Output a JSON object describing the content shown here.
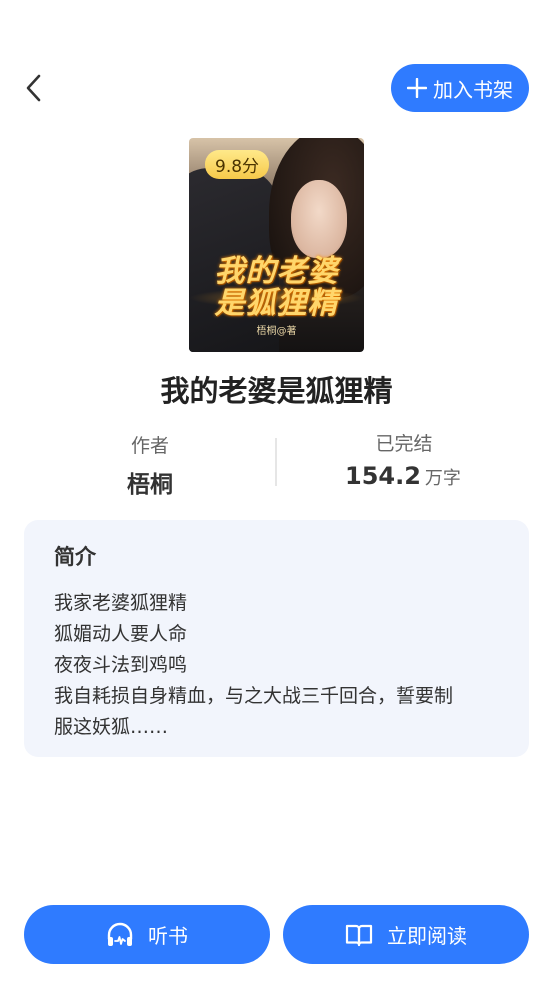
{
  "header": {
    "back_icon": "chevron-left-icon",
    "add_shelf_label": "加入书架",
    "add_shelf_icon": "plus-icon"
  },
  "cover": {
    "rating": "9.8分",
    "title_line1": "我的老婆",
    "title_line2": "是狐狸精",
    "author_credit": "梧桐@著"
  },
  "book": {
    "title": "我的老婆是狐狸精",
    "author_label": "作者",
    "author_name": "梧桐",
    "status": "已完结",
    "word_count": "154.2",
    "word_unit": "万字"
  },
  "intro": {
    "heading": "简介",
    "lines": [
      "我家老婆狐狸精",
      "狐媚动人要人命",
      "夜夜斗法到鸡鸣",
      "我自耗损自身精血，与之大战三千回合，誓要制",
      "服这妖狐……"
    ]
  },
  "actions": {
    "listen_label": "听书",
    "listen_icon": "headphones-icon",
    "read_label": "立即阅读",
    "read_icon": "open-book-icon"
  },
  "colors": {
    "accent": "#2f7bff",
    "card_bg": "#f2f5fc"
  }
}
